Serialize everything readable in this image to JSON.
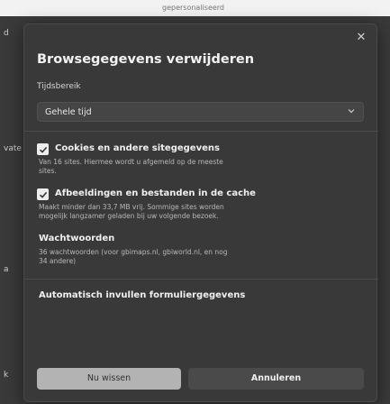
{
  "backdrop": {
    "top_text": "gepersonaliseerd",
    "left_vate": "vate",
    "left_a": "a",
    "left_k": "k",
    "left_d": "d"
  },
  "dialog": {
    "title": "Browsegegevens verwijderen",
    "time_range_label": "Tijdsbereik",
    "time_range_value": "Gehele tijd",
    "options": [
      {
        "title": "Cookies en andere sitegegevens",
        "desc_lines": [
          "Van 16 sites. Hiermee wordt u afgemeld op de meeste",
          "sites."
        ],
        "checked": true
      },
      {
        "title": "Afbeeldingen en bestanden in de cache",
        "desc_lines": [
          "Maakt minder dan 33,7 MB vrij. Sommige sites worden",
          "mogelijk langzamer geladen bij uw volgende bezoek."
        ],
        "checked": true
      },
      {
        "title": "Wachtwoorden",
        "desc_lines": [
          "36 wachtwoorden (voor gbimaps.nl, gbiworld.nl, en nog",
          "34 andere)"
        ],
        "checked": false
      },
      {
        "title": "Automatisch invullen formuliergegevens",
        "desc_lines": [],
        "checked": false
      }
    ],
    "remove_label": "Nu wissen",
    "cancel_label": "Annuleren"
  },
  "colors": {
    "dialog_bg": "#393939",
    "checkbox_checked": "#ededed",
    "remove_button": "#b3b3b3"
  }
}
